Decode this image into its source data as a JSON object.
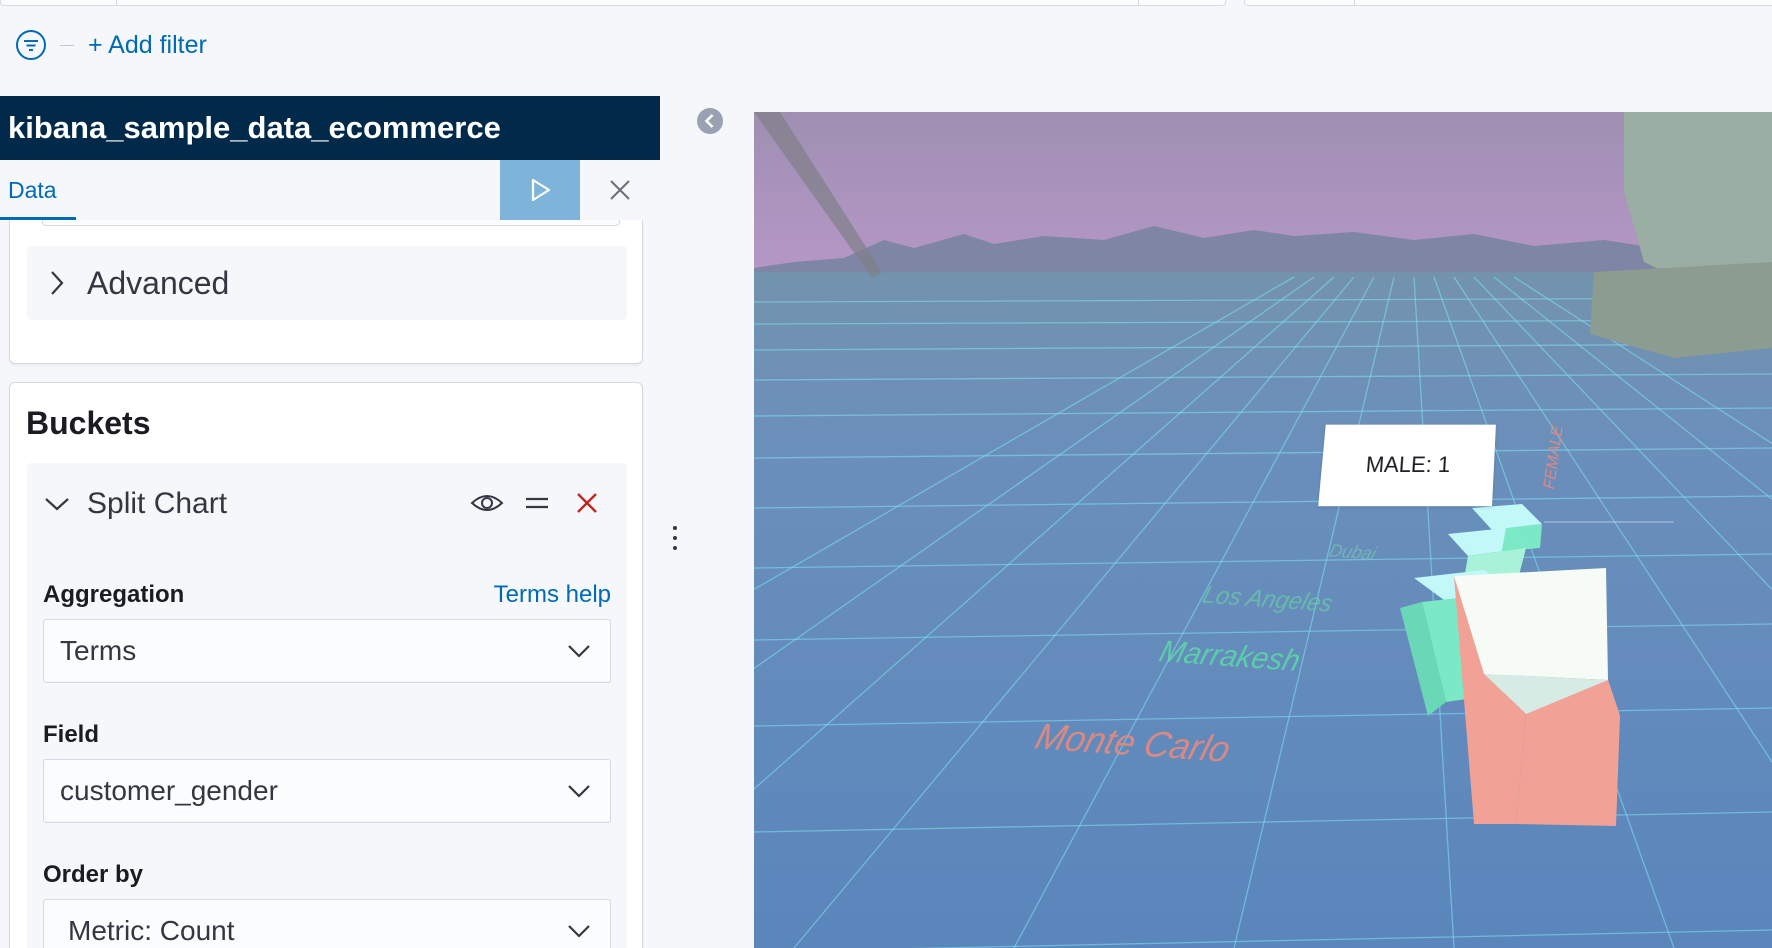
{
  "filter": {
    "add_label": "+ Add filter"
  },
  "sidebar": {
    "index_pattern": "kibana_sample_data_ecommerce",
    "tabs": [
      {
        "label": "Data"
      }
    ],
    "advanced_label": "Advanced",
    "buckets": {
      "title": "Buckets",
      "item": {
        "title": "Split Chart",
        "aggregation": {
          "label": "Aggregation",
          "help": "Terms help",
          "value": "Terms"
        },
        "field": {
          "label": "Field",
          "value": "customer_gender"
        },
        "order_by": {
          "label": "Order by",
          "value": "Metric: Count"
        }
      }
    }
  },
  "scene": {
    "tooltip": "MALE: 1",
    "labels": {
      "monte_carlo": "Monte Carlo",
      "marrakesh": "Marrakesh",
      "los_angeles": "Los Angeles",
      "dubai": "Dubai",
      "female": "FEMALE"
    },
    "colors": {
      "sky": "#b597c6",
      "floor": "#5e87ba",
      "grid": "#7fe3f2",
      "bar_pink": "#f2a196",
      "bar_green": "#7be8c6",
      "bar_cyan": "#c2f8f8"
    }
  },
  "theme": {
    "accent": "#006bb4",
    "header_bg": "#012a4a",
    "danger": "#bd271e",
    "play_bg": "#7fb4da"
  }
}
